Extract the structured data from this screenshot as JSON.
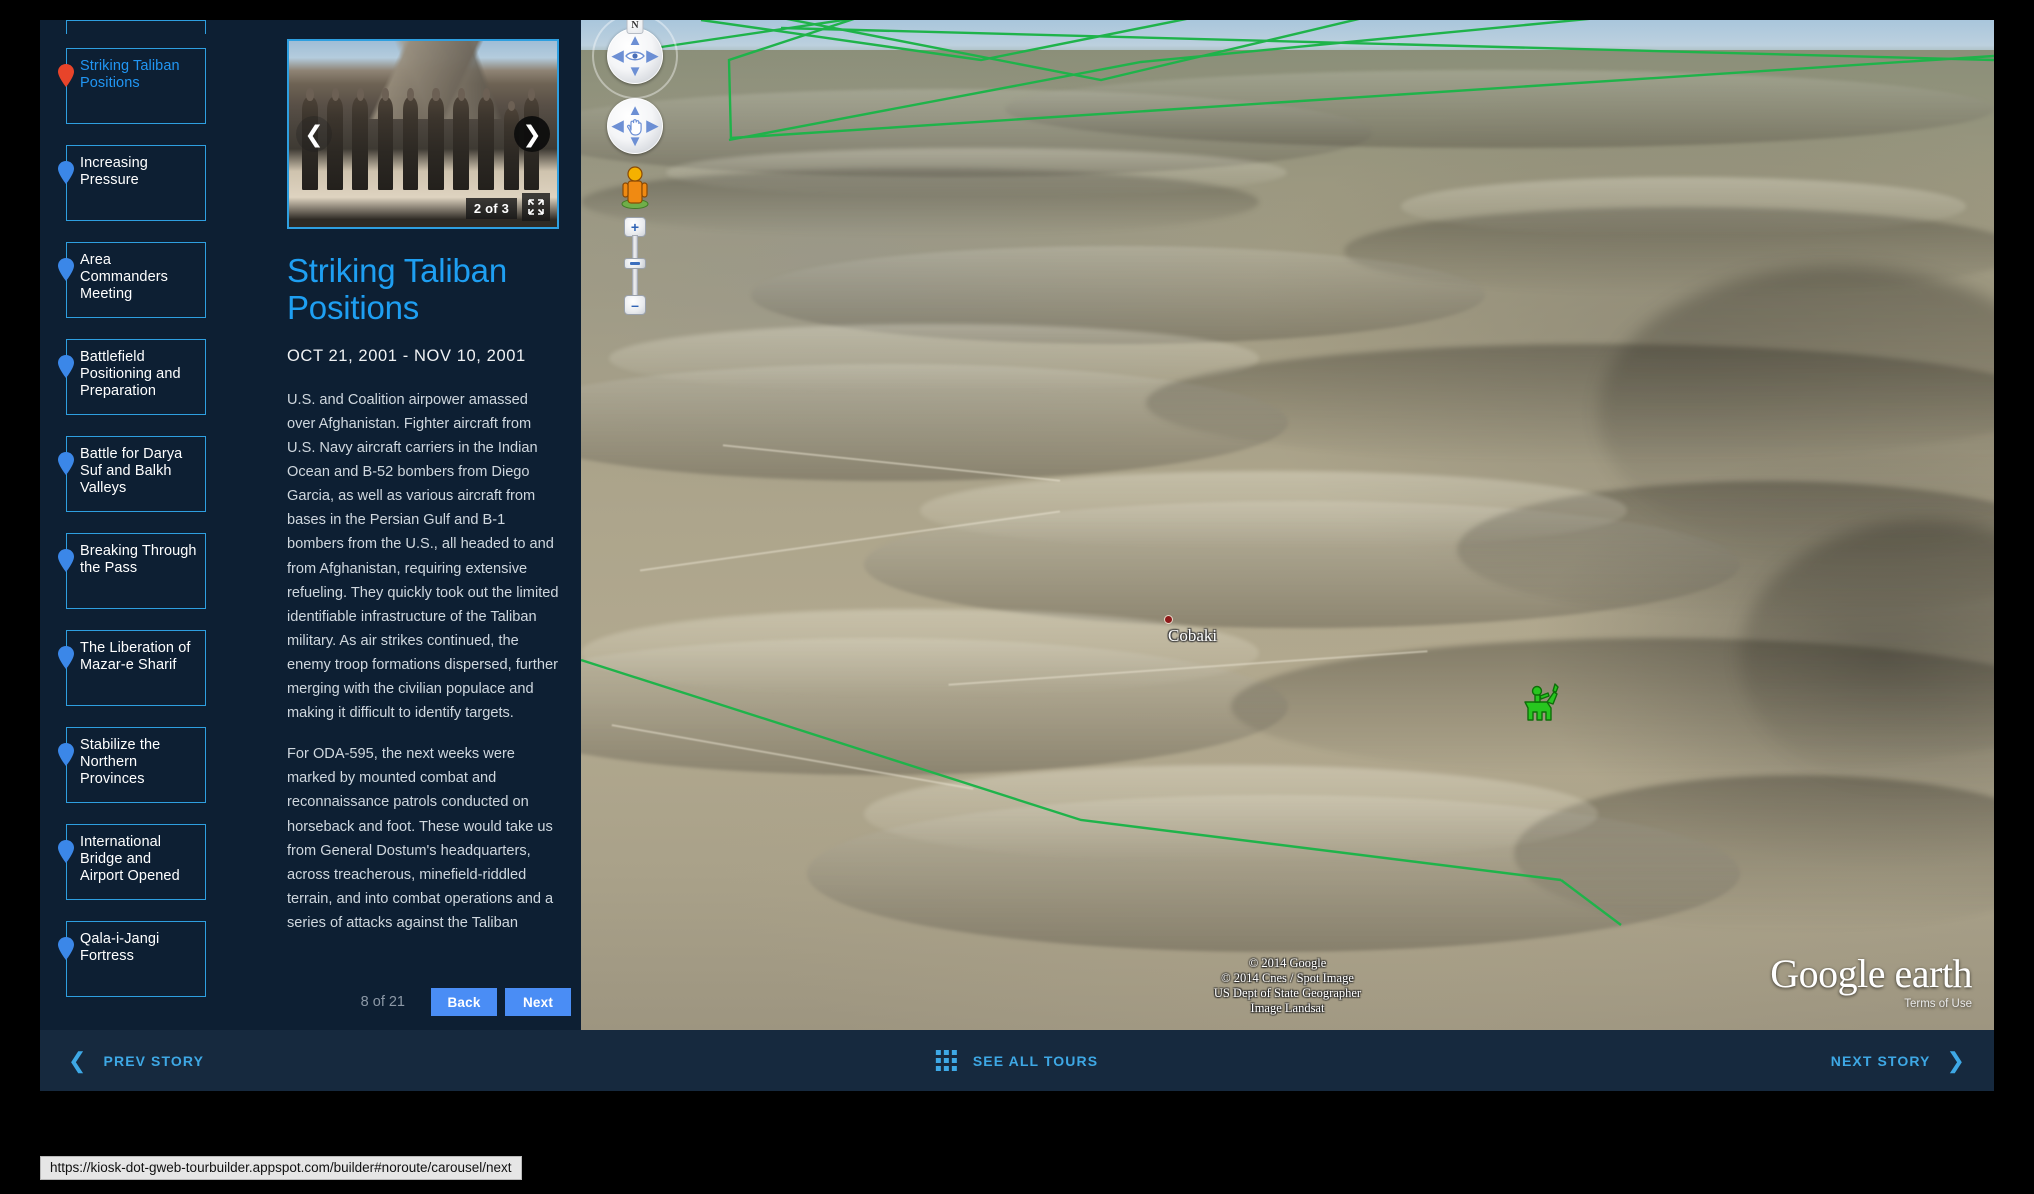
{
  "sidebar": {
    "chapters": [
      {
        "label": "",
        "active": false,
        "partial": true
      },
      {
        "label": "Striking Taliban Positions",
        "active": true,
        "partial": false
      },
      {
        "label": "Increasing Pressure",
        "active": false,
        "partial": false
      },
      {
        "label": "Area Commanders Meeting",
        "active": false,
        "partial": false
      },
      {
        "label": "Battlefield Positioning and Preparation",
        "active": false,
        "partial": false
      },
      {
        "label": "Battle for Darya Suf and Balkh Valleys",
        "active": false,
        "partial": false
      },
      {
        "label": "Breaking Through the Pass",
        "active": false,
        "partial": false
      },
      {
        "label": "The Liberation of Mazar-e Sharif",
        "active": false,
        "partial": false
      },
      {
        "label": "Stabilize the Northern Provinces",
        "active": false,
        "partial": false
      },
      {
        "label": "International Bridge and Airport Opened",
        "active": false,
        "partial": false
      },
      {
        "label": "Qala-i-Jangi Fortress",
        "active": false,
        "partial": false
      }
    ]
  },
  "story": {
    "carousel": {
      "counter": "2 of 3",
      "prev_icon": "chevron-left-icon",
      "next_icon": "chevron-right-icon",
      "expand_icon": "expand-icon"
    },
    "title": "Striking Taliban Positions",
    "date_range": "OCT 21, 2001 - NOV 10, 2001",
    "paragraphs": [
      "U.S. and Coalition airpower amassed over Afghanistan. Fighter aircraft from U.S. Navy aircraft carriers in the Indian Ocean and B-52 bombers from Diego Garcia, as well as various aircraft from bases in the Persian Gulf and B-1 bombers from the U.S., all headed to and from Afghanistan, requiring extensive refueling. They quickly took out the limited identifiable infrastructure of the Taliban military. As air strikes continued, the enemy troop formations dispersed, further merging with the civilian populace and making it difficult to identify targets.",
      "For ODA-595, the next weeks were marked by mounted combat and reconnaissance patrols conducted on horseback and foot. These would take us from General Dostum's headquarters, across treacherous, minefield-riddled terrain, and into combat operations and a series of attacks against the Taliban"
    ],
    "page_counter": "8 of 21",
    "back_label": "Back",
    "next_label": "Next"
  },
  "map": {
    "compass_label": "N",
    "look_joystick_icon": "eye-icon",
    "move_joystick_icon": "hand-icon",
    "pegman_icon": "pegman-icon",
    "zoom_in_label": "+",
    "zoom_out_label": "–",
    "placemark_label": "Cobaki",
    "attribution": [
      "© 2014 Google",
      "© 2014 Cnes / Spot Image",
      "US Dept of State Geographer",
      "Image Landsat"
    ],
    "logo_text": "Google earth",
    "terms_text": "Terms of Use",
    "path_color": "#1fb34a"
  },
  "bottombar": {
    "prev_label": "PREV STORY",
    "prev_icon": "chevron-left-icon",
    "all_tours_label": "SEE ALL TOURS",
    "all_tours_icon": "grid-icon",
    "next_label": "NEXT STORY",
    "next_icon": "chevron-right-icon"
  },
  "statusbar": {
    "url": "https://kiosk-dot-gweb-tourbuilder.appspot.com/builder#noroute/carousel/next"
  }
}
